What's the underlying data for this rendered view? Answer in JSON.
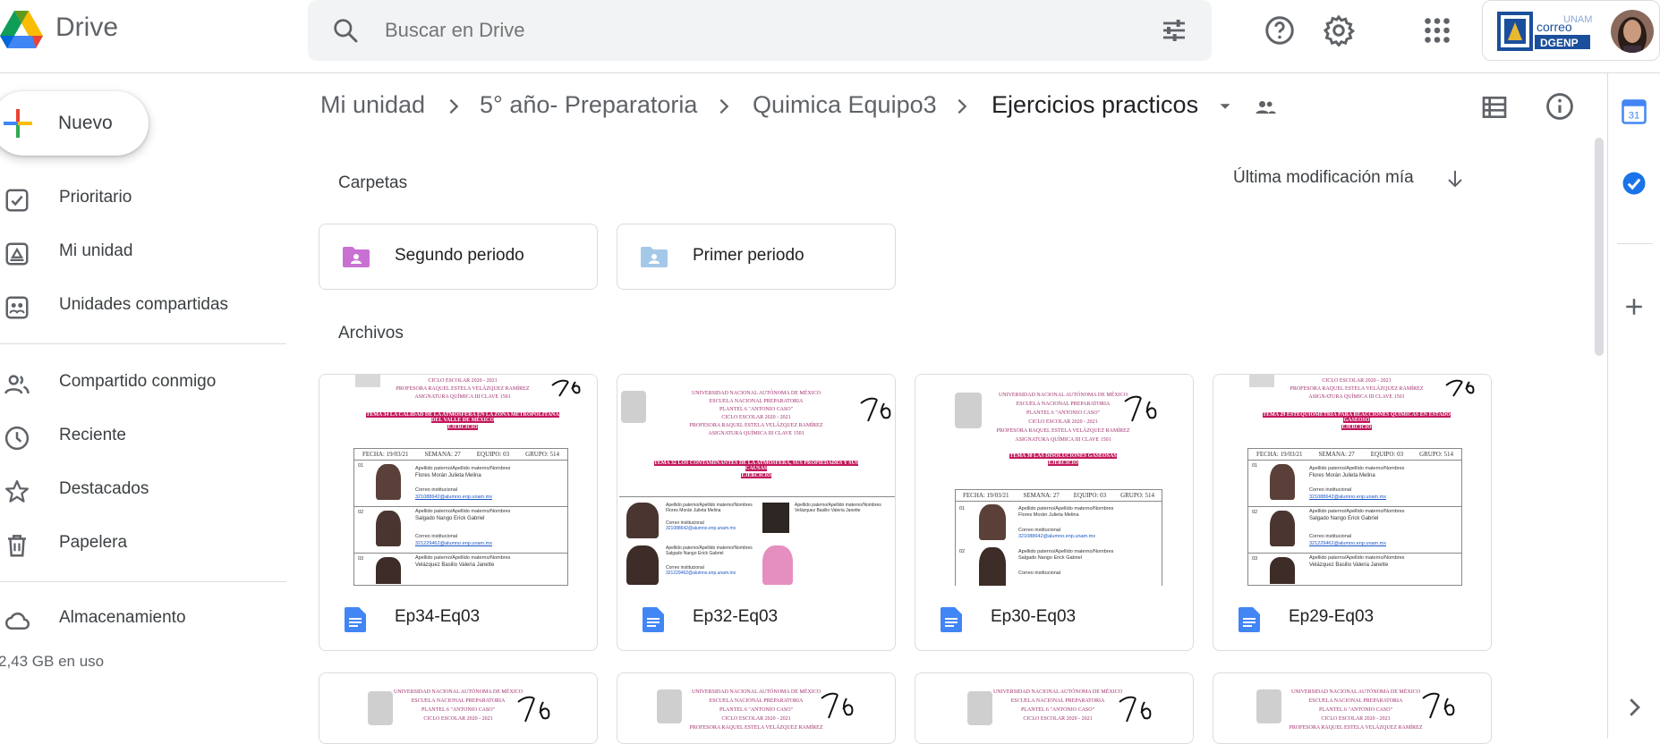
{
  "app": {
    "brand": "Drive"
  },
  "search": {
    "placeholder": "Buscar en Drive"
  },
  "account": {
    "logo_text_1": "correo",
    "logo_text_2": "DGENP",
    "logo_text_3": "UNAM"
  },
  "sidebar": {
    "new_label": "Nuevo",
    "items": [
      {
        "label": "Prioritario"
      },
      {
        "label": "Mi unidad"
      },
      {
        "label": "Unidades compartidas"
      },
      {
        "label": "Compartido conmigo"
      },
      {
        "label": "Reciente"
      },
      {
        "label": "Destacados"
      },
      {
        "label": "Papelera"
      },
      {
        "label": "Almacenamiento"
      }
    ],
    "storage_used": "2,43 GB en uso"
  },
  "breadcrumb": [
    "Mi unidad",
    "5° año- Preparatoria",
    "Quimica Equipo3",
    "Ejercicios practicos"
  ],
  "content": {
    "folders_title": "Carpetas",
    "files_title": "Archivos",
    "sort_label": "Última modificación mía",
    "folders": [
      {
        "name": "Segundo periodo",
        "color": "#c971d3"
      },
      {
        "name": "Primer periodo",
        "color": "#a4c8e8"
      }
    ],
    "files": [
      {
        "name": "Ep34-Eq03",
        "thumb_title": "TEMA 34 LA CALIDAD DE LA ATMÓSFERA EN LA ZONA METROPOLITANA DEL VALLE DE MÉXICO"
      },
      {
        "name": "Ep32-Eq03",
        "thumb_title": "TEMA 32 LOS CONTAMINANTES DE LA ATMÓSFERA, SUS PROPIEDADES Y SUS CAUSAS"
      },
      {
        "name": "Ep30-Eq03",
        "thumb_title": "TEMA 30 LAS DISOLUCIONES GASEOSAS"
      },
      {
        "name": "Ep29-Eq03",
        "thumb_title": "TEMA 29 ESTEQUIOMETRÍA PARA REACCIONES QUÍMICAS EN ESTADO GASEOSO"
      }
    ],
    "thumb_common": {
      "university": "UNIVERSIDAD NACIONAL AUTÓNOMA DE MÉXICO",
      "school": "ESCUELA NACIONAL PREPARATORIA",
      "plantel": "PLANTEL 6 \"ANTONIO CASO\"",
      "ciclo": "CICLO ESCOLAR 2020 - 2021",
      "profesora": "PROFESORA RAQUEL ESTELA VELÁZQUEZ RAMÍREZ",
      "asignatura": "ASIGNATURA QUÍMICA III CLAVE 1501",
      "ejercicio": "EJERCICIO",
      "fecha": "FECHA: 19/03/21",
      "semana": "SEMANA: 27",
      "equipo": "EQUIPO: 03",
      "grupo": "GRUPO: 514",
      "label_name": "Apellido paterno/Apellido materno/Nombres",
      "label_mail": "Correo institucional",
      "student1": "Flores Morán Julieta Melina",
      "mail1": "321088642@alumno.enp.unam.mx",
      "student2": "Salgado Nango Erick Gabriel",
      "mail2": "321229462@alumno.enp.unam.mx",
      "student3": "Velázquez Basilio Valeria Janette",
      "row1": "01",
      "row2": "02",
      "row3": "03"
    }
  }
}
